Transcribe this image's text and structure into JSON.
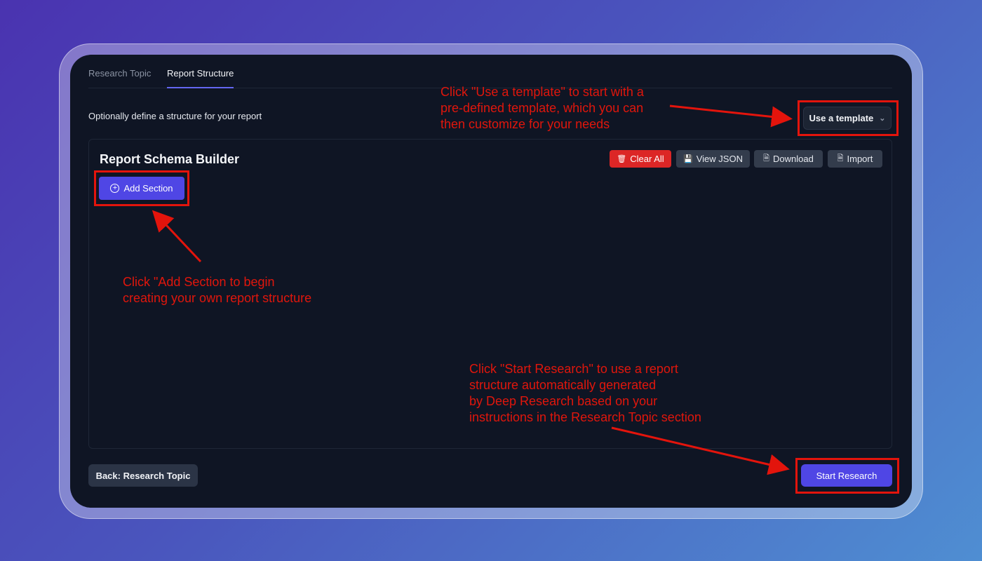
{
  "tabs": [
    {
      "label": "Research Topic",
      "active": false
    },
    {
      "label": "Report Structure",
      "active": true
    }
  ],
  "subtitle": "Optionally define a structure for your report",
  "template_button": {
    "label": "Use a template"
  },
  "builder": {
    "title": "Report Schema Builder",
    "actions": {
      "clear_all": "Clear All",
      "view_json": "View JSON",
      "download": "Download",
      "import": "Import"
    },
    "add_section": "Add Section"
  },
  "footer": {
    "back": "Back: Research Topic",
    "start": "Start Research"
  },
  "annotations": {
    "template_note": "Click \"Use a template\" to start with a\npre-defined template, which you can\nthen customize for your needs",
    "add_section_note": "Click \"Add Section to begin\ncreating your own report structure",
    "start_note": "Click \"Start Research\" to use a report\nstructure automatically generated\nby Deep Research based on your\ninstructions in the Research Topic section"
  },
  "colors": {
    "accent": "#4f46e5",
    "danger": "#dc2626",
    "annotation": "#e3140c",
    "panel_bg": "#0f1524"
  }
}
